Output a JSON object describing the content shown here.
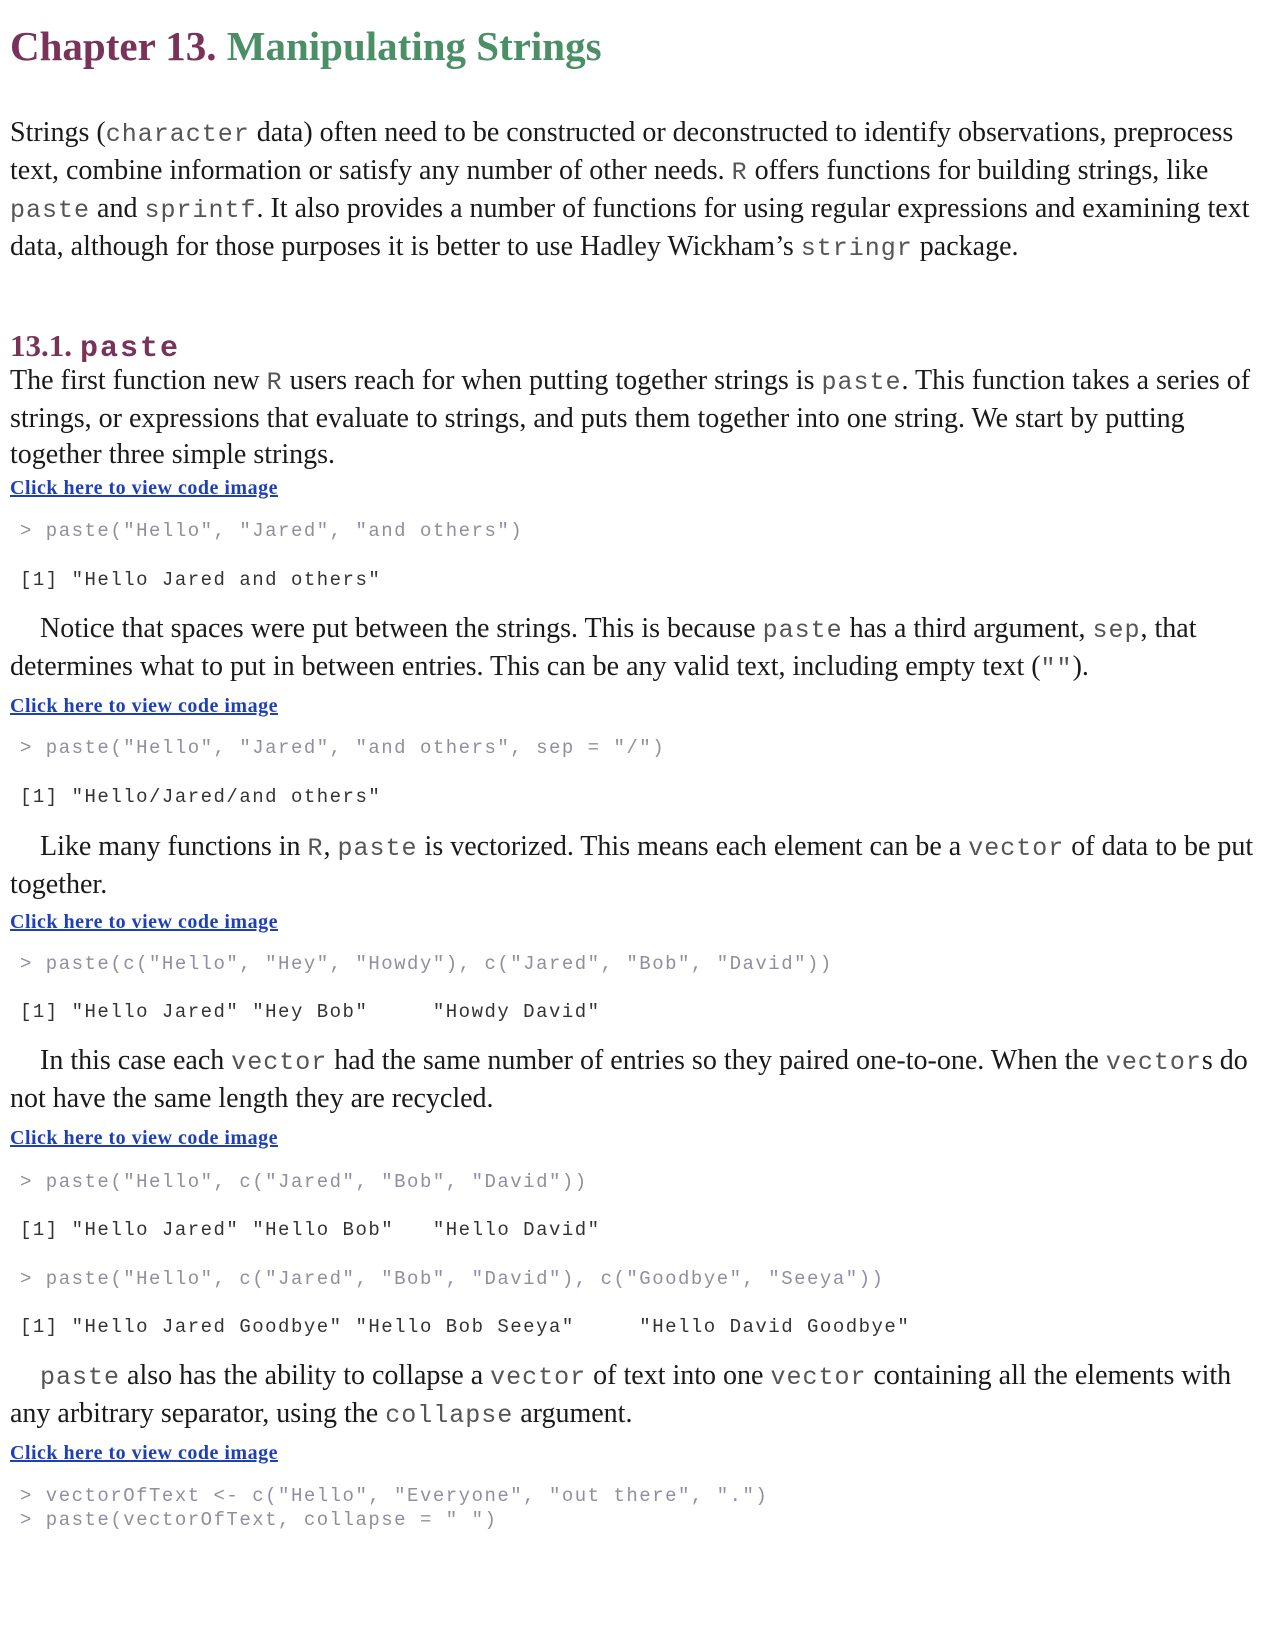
{
  "chapter": {
    "number": "Chapter 13.",
    "title": "Manipulating Strings"
  },
  "intro": {
    "part1": "Strings (",
    "code1": "character",
    "part2": " data) often need to be constructed or deconstructed to identify observations, preprocess text, combine information or satisfy any number of other needs. ",
    "code2": "R",
    "part3": " offers functions for building strings, like ",
    "code3": "paste",
    "part4": " and ",
    "code4": "sprintf",
    "part5": ". It also provides a number of functions for using regular expressions and examining text data, although for those purposes it is better to use Hadley Wickham’s ",
    "code5": "stringr",
    "part6": " package."
  },
  "section": {
    "number": "13.1.",
    "title_code": "paste"
  },
  "p1": {
    "part1": "The first function new ",
    "code1": "R",
    "part2": " users reach for when putting together strings is ",
    "code2": "paste",
    "part3": ". This function takes a series of strings, or expressions that evaluate to strings, and puts them together into one string. We start by putting together three simple strings."
  },
  "link_label": "Click here to view code image",
  "code1": {
    "input": "> paste(\"Hello\", \"Jared\", \"and others\")",
    "output": "[1] \"Hello Jared and others\""
  },
  "p2": {
    "part1": "Notice that spaces were put between the strings. This is because ",
    "code1": "paste",
    "part2": " has a third argument, ",
    "code2": "sep",
    "part3": ", that determines what to put in between entries. This can be any valid text, including empty text (",
    "code3": "\"\"",
    "part4": ")."
  },
  "code2": {
    "input": "> paste(\"Hello\", \"Jared\", \"and others\", sep = \"/\")",
    "output": "[1] \"Hello/Jared/and others\""
  },
  "p3": {
    "part1": "Like many functions in ",
    "code1": "R",
    "part2": ", ",
    "code2": "paste",
    "part3": " is vectorized. This means each element can be a ",
    "code3": "vector",
    "part4": " of data to be put together."
  },
  "code3": {
    "input": "> paste(c(\"Hello\", \"Hey\", \"Howdy\"), c(\"Jared\", \"Bob\", \"David\"))",
    "output": "[1] \"Hello Jared\" \"Hey Bob\"     \"Howdy David\""
  },
  "p4": {
    "part1": "In this case each ",
    "code1": "vector",
    "part2": " had the same number of entries so they paired one-to-one. When the ",
    "code2": "vector",
    "part3": "s do not have the same length they are recycled."
  },
  "code4": {
    "input1": "> paste(\"Hello\", c(\"Jared\", \"Bob\", \"David\"))",
    "output1": "[1] \"Hello Jared\" \"Hello Bob\"   \"Hello David\"",
    "input2": "> paste(\"Hello\", c(\"Jared\", \"Bob\", \"David\"), c(\"Goodbye\", \"Seeya\"))",
    "output2": "[1] \"Hello Jared Goodbye\" \"Hello Bob Seeya\"     \"Hello David Goodbye\""
  },
  "p5": {
    "code1": "paste",
    "part1": " also has the ability to collapse a ",
    "code2": "vector",
    "part2": " of text into one ",
    "code3": "vector",
    "part3": " containing all the elements with any arbitrary separator, using the ",
    "code4": "collapse",
    "part4": " argument."
  },
  "code5": {
    "line1": "> vectorOfText <- c(\"Hello\", \"Everyone\", \"out there\", \".\")",
    "line2": "> paste(vectorOfText, collapse = \" \")"
  }
}
